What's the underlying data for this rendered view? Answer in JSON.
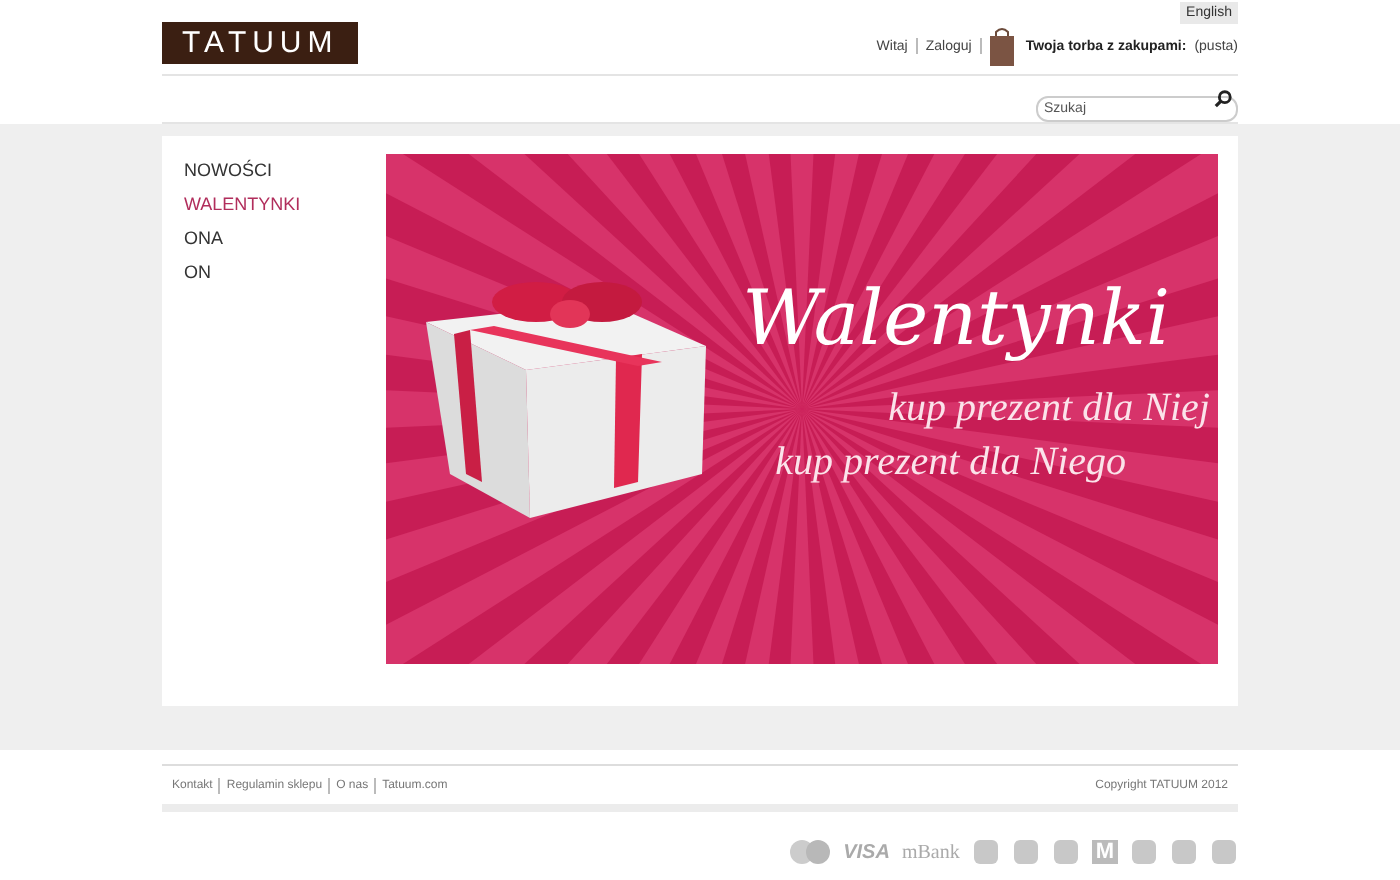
{
  "header": {
    "logo": "TATUUM",
    "language": "English",
    "greeting": "Witaj",
    "login": "Zaloguj",
    "cart": {
      "label": "Twoja torba z zakupami:",
      "status": "(pusta)"
    },
    "search": {
      "placeholder": "Szukaj"
    }
  },
  "menu": [
    {
      "label": "NOWOŚCI",
      "selected": false
    },
    {
      "label": "WALENTYNKI",
      "selected": true
    },
    {
      "label": "ONA",
      "selected": false
    },
    {
      "label": "ON",
      "selected": false
    }
  ],
  "banner": {
    "title": "Walentynki",
    "lines": [
      "kup prezent dla Niej",
      "kup prezent dla Niego"
    ]
  },
  "footer": {
    "links": [
      "Kontakt",
      "Regulamin sklepu",
      "O nas",
      "Tatuum.com"
    ],
    "copyright": "Copyright TATUUM 2012"
  },
  "payment_logos": [
    {
      "kind": "card"
    },
    {
      "kind": "text",
      "label": "VISA"
    },
    {
      "kind": "text",
      "label": "mBank"
    },
    {
      "kind": "icon"
    },
    {
      "kind": "icon"
    },
    {
      "kind": "icon"
    },
    {
      "kind": "letter",
      "label": "M"
    },
    {
      "kind": "icon"
    },
    {
      "kind": "icon"
    },
    {
      "kind": "icon"
    }
  ]
}
